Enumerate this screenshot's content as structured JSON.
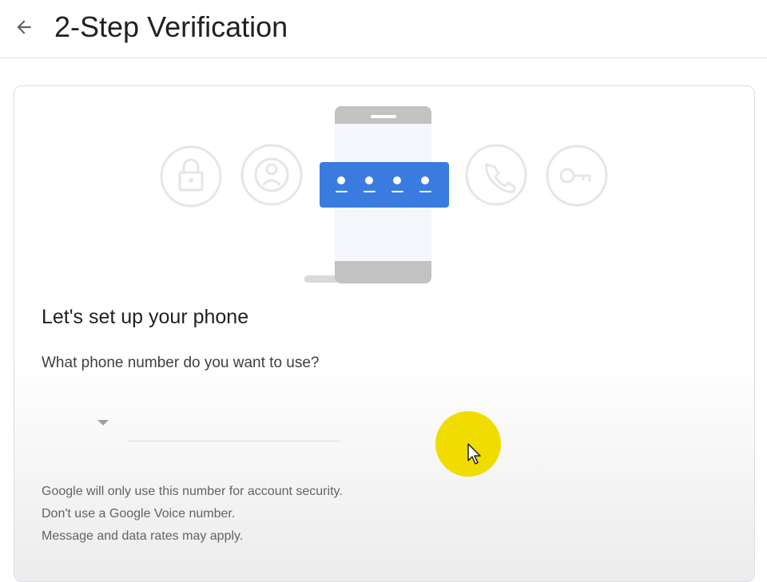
{
  "header": {
    "title": "2-Step Verification",
    "back_icon": "arrow-left-icon"
  },
  "illustration": {
    "icons": [
      "lock-icon",
      "user-circle-icon",
      "phone-icon",
      "key-icon"
    ],
    "code_dots": 4,
    "accent_color": "#3a7be0"
  },
  "setup": {
    "title": "Let's set up your phone",
    "question": "What phone number do you want to use?",
    "country_dropdown_icon": "caret-down-icon",
    "phone_value": "",
    "notes": [
      "Google will only use this number for account security.",
      "Don't use a Google Voice number.",
      "Message and data rates may apply."
    ]
  },
  "colors": {
    "cursor_highlight": "#f1dc00",
    "title_text": "#202124",
    "secondary_text": "#5f6368"
  }
}
